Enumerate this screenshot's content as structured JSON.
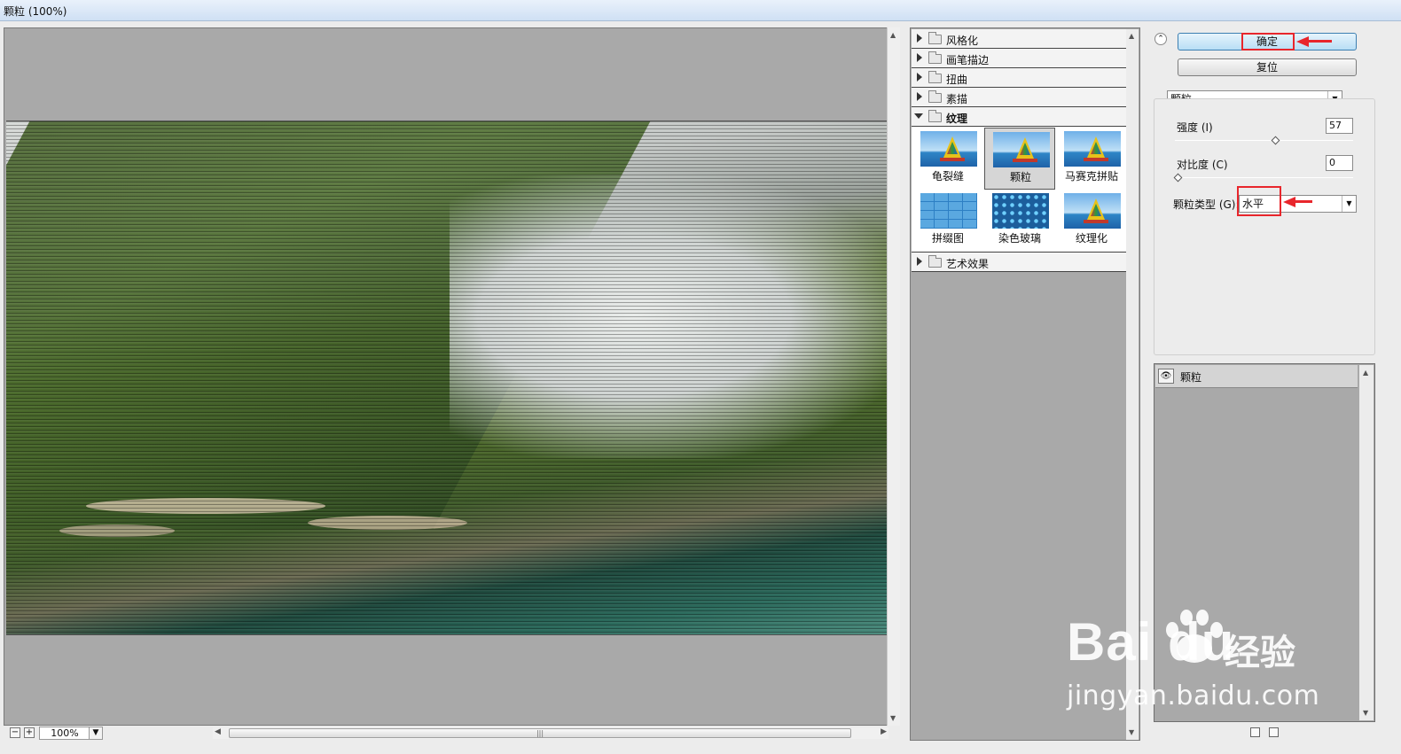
{
  "window": {
    "title": "颗粒 (100%)"
  },
  "zoom": {
    "value": "100%",
    "minus": "−",
    "plus": "+"
  },
  "gallery": {
    "categories": [
      {
        "label": "风格化"
      },
      {
        "label": "画笔描边"
      },
      {
        "label": "扭曲"
      },
      {
        "label": "素描"
      },
      {
        "label": "纹理"
      },
      {
        "label": "艺术效果"
      }
    ],
    "texture_filters": [
      {
        "label": "龟裂缝"
      },
      {
        "label": "颗粒"
      },
      {
        "label": "马赛克拼贴"
      },
      {
        "label": "拼缀图"
      },
      {
        "label": "染色玻璃"
      },
      {
        "label": "纹理化"
      }
    ],
    "selected_filter": "颗粒"
  },
  "buttons": {
    "ok": "确定",
    "reset": "复位"
  },
  "filter_select": {
    "value": "颗粒"
  },
  "params": {
    "intensity_label": "强度 (I)",
    "intensity_value": "57",
    "intensity_fraction": 0.57,
    "contrast_label": "对比度 (C)",
    "contrast_value": "0",
    "contrast_fraction": 0.0,
    "grain_type_label": "颗粒类型 (G):",
    "grain_type_value": "水平"
  },
  "layers": {
    "items": [
      {
        "label": "颗粒"
      }
    ]
  },
  "watermark": {
    "brand": "Bai  du",
    "cn": "经验",
    "url": "jingyan.baidu.com"
  },
  "colors": {
    "annotation_red": "#e8262c",
    "ok_button_blue": "#b8def5"
  }
}
